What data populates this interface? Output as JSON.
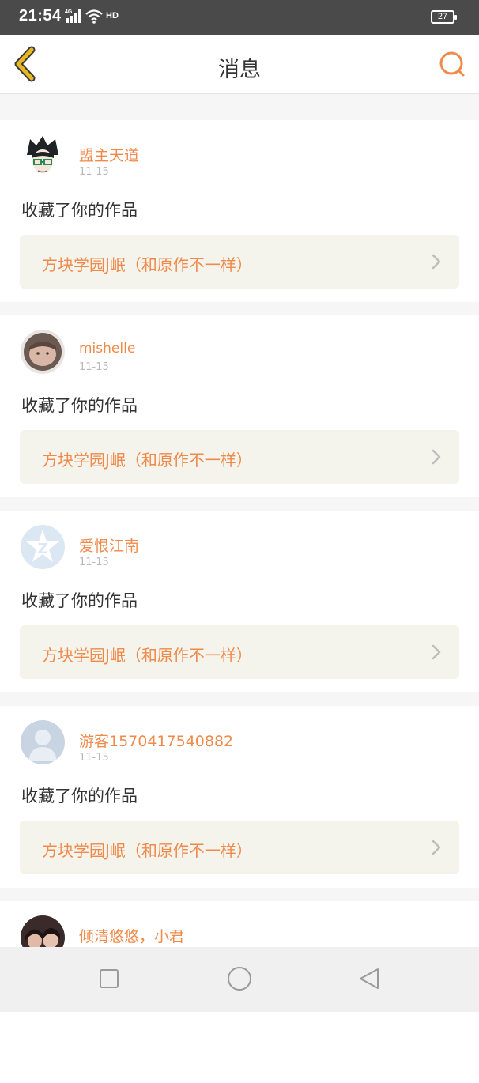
{
  "status_bar": {
    "time": "21:54",
    "network": "4G",
    "hd_label": "HD",
    "battery": "27"
  },
  "nav": {
    "title": "消息",
    "back_icon": "back-chevron-icon",
    "search_icon": "search-icon"
  },
  "colors": {
    "accent": "#f08a4b",
    "nav_icon": "#e8b820",
    "card_bg": "#ffffff",
    "link_bg": "#f4f4ec"
  },
  "messages": [
    {
      "user": "盟主天道",
      "date": "11-15",
      "action": "收藏了你的作品",
      "work": "方块学园J岷（和原作不一样）",
      "avatar": "anime-avatar"
    },
    {
      "user": "mishelle",
      "date": "11-15",
      "action": "收藏了你的作品",
      "work": "方块学园J岷（和原作不一样）",
      "avatar": "photo-avatar"
    },
    {
      "user": "爱恨江南",
      "date": "11-15",
      "action": "收藏了你的作品",
      "work": "方块学园J岷（和原作不一样）",
      "avatar": "qq-avatar"
    },
    {
      "user": "游客1570417540882",
      "date": "11-15",
      "action": "收藏了你的作品",
      "work": "方块学园J岷（和原作不一样）",
      "avatar": "default-avatar"
    },
    {
      "user": "倾清悠悠，小君",
      "date": "",
      "action": "",
      "work": "",
      "avatar": "photo-avatar"
    }
  ],
  "bottom_nav": {
    "buttons": [
      "recent-apps-icon",
      "home-icon",
      "back-triangle-icon"
    ]
  }
}
